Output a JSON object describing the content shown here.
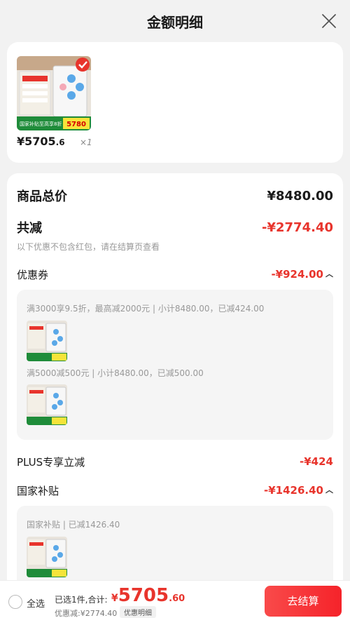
{
  "header": {
    "title": "金额明细"
  },
  "product": {
    "price_int": "¥5705",
    "price_dec": ".6",
    "quantity": "×1",
    "image_texts": {
      "big_price": "5780",
      "subsidy": "国家补贴至高享8折"
    }
  },
  "summary": {
    "total_label": "商品总价",
    "total_value": "¥8480.00",
    "discount_label": "共减",
    "discount_value": "-¥2774.40",
    "discount_note": "以下优惠不包含红包，请在结算页查看"
  },
  "coupon": {
    "label": "优惠券",
    "value": "-¥924.00",
    "items": [
      {
        "text": "满3000享9.5折，最高减2000元 | 小计8480.00，已减424.00"
      },
      {
        "text": "满5000减500元 | 小计8480.00，已减500.00"
      }
    ]
  },
  "plus": {
    "label": "PLUS专享立减",
    "value": "-¥424"
  },
  "subsidy": {
    "label": "国家补贴",
    "value": "-¥1426.40",
    "items": [
      {
        "text": "国家补贴 | 已减1426.40"
      }
    ]
  },
  "bottom": {
    "select_all": "全选",
    "selected_text": "已选1件,合计:",
    "total_cur": "¥",
    "total_int": "5705",
    "total_dec": ".60",
    "discount_text": "优惠减:¥2774.40",
    "detail_tag": "优惠明细",
    "checkout": "去结算"
  },
  "colors": {
    "accent_red": "#e8342c",
    "button_red": "#f5232a"
  }
}
